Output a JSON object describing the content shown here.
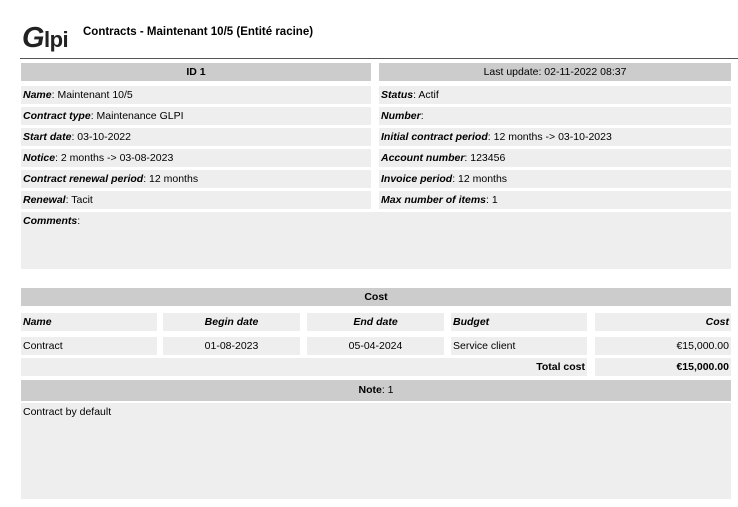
{
  "header": {
    "logo_text": "Glpi",
    "title": "Contracts - Maintenant 10/5  (Entité racine)"
  },
  "summary": {
    "id_label": "ID 1",
    "last_update": "Last update: 02-11-2022 08:37"
  },
  "fields_left": [
    {
      "label": "Name",
      "value": ": Maintenant 10/5"
    },
    {
      "label": "Contract type",
      "value": ": Maintenance GLPI"
    },
    {
      "label": "Start date",
      "value": ": 03-10-2022"
    },
    {
      "label": "Notice",
      "value": ": 2 months -> 03-08-2023"
    },
    {
      "label": "Contract renewal period",
      "value": ": 12 months"
    },
    {
      "label": "Renewal",
      "value": ": Tacit"
    }
  ],
  "fields_right": [
    {
      "label": "Status",
      "value": ": Actif"
    },
    {
      "label": "Number",
      "value": ":"
    },
    {
      "label": "Initial contract period",
      "value": ": 12 months -> 03-10-2023"
    },
    {
      "label": "Account number",
      "value": ": 123456"
    },
    {
      "label": "Invoice period",
      "value": ": 12 months"
    },
    {
      "label": "Max number of items",
      "value": ": 1"
    }
  ],
  "comments": {
    "label": "Comments",
    "value": ":"
  },
  "cost": {
    "title": "Cost",
    "headers": {
      "name": "Name",
      "begin": "Begin date",
      "end": "End date",
      "budget": "Budget",
      "cost": "Cost"
    },
    "rows": [
      {
        "name": "Contract",
        "begin": "01-08-2023",
        "end": "05-04-2024",
        "budget": "Service client",
        "cost": "€15,000.00"
      }
    ],
    "total_label": "Total cost",
    "total_value": "€15,000.00"
  },
  "note": {
    "label": "Note",
    "count": ": 1",
    "text": "Contract by default"
  }
}
